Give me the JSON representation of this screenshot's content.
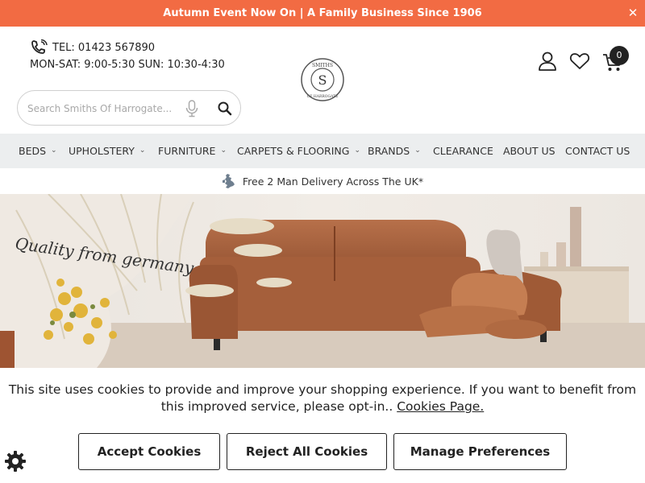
{
  "promo": {
    "text": "Autumn Event Now On | A Family Business Since 1906",
    "close": "✕"
  },
  "contact": {
    "tel": "TEL: 01423 567890",
    "hours": "MON-SAT: 9:00-5:30 SUN: 10:30-4:30"
  },
  "search": {
    "placeholder": "Search Smiths Of Harrogate..."
  },
  "logo": {
    "letter": "S",
    "top_text": "SMITHS",
    "bottom_text": "OF HARROGATE"
  },
  "cart": {
    "count": "0"
  },
  "nav": {
    "items": [
      {
        "label": "BEDS",
        "dropdown": true
      },
      {
        "label": "UPHOLSTERY",
        "dropdown": true
      },
      {
        "label": "FURNITURE",
        "dropdown": true
      },
      {
        "label": "CARPETS & FLOORING",
        "dropdown": true
      },
      {
        "label": "BRANDS",
        "dropdown": true
      },
      {
        "label": "CLEARANCE",
        "dropdown": false
      },
      {
        "label": "ABOUT US",
        "dropdown": false
      },
      {
        "label": "CONTACT US",
        "dropdown": false
      }
    ]
  },
  "delivery": {
    "text": "Free 2 Man Delivery Across The UK*"
  },
  "hero": {
    "script_text": "Quality from germany"
  },
  "cookie": {
    "message": "This site uses cookies to provide and improve your shopping experience. If you want to benefit from this improved service, please opt-in..",
    "link": "Cookies Page.",
    "accept": "Accept Cookies",
    "reject": "Reject All Cookies",
    "manage": "Manage Preferences"
  },
  "icons": {
    "phone": "phone-icon",
    "mic": "microphone-icon",
    "search": "search-icon",
    "user": "user-icon",
    "heart": "heart-icon",
    "cart": "cart-icon",
    "delivery": "uk-map-icon",
    "gear": "gear-icon"
  },
  "colors": {
    "promo_bg": "#f26b43",
    "nav_bg": "#eceeef",
    "text": "#222222"
  }
}
